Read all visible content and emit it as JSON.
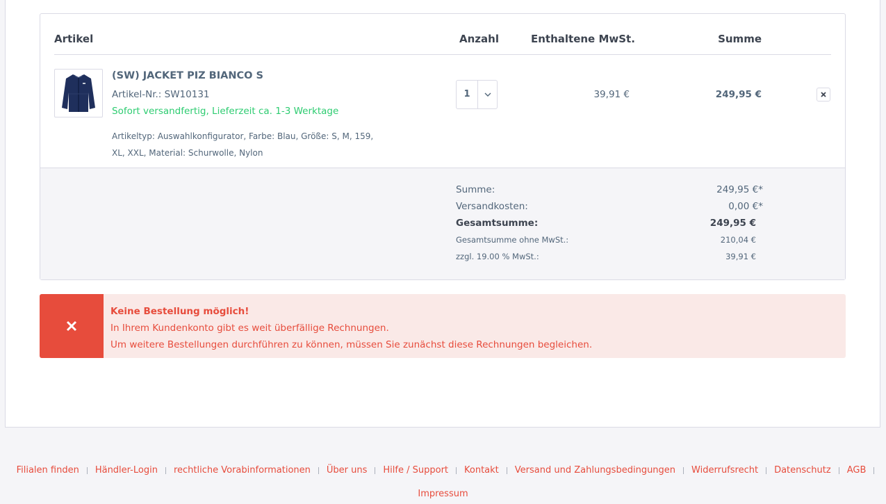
{
  "cart": {
    "headers": {
      "artikel": "Artikel",
      "anzahl": "Anzahl",
      "mwst": "Enthaltene MwSt.",
      "summe": "Summe"
    },
    "item": {
      "name": "(SW) JACKET PIZ BIANCO S",
      "article_number": "Artikel-Nr.: SW10131",
      "delivery": "Sofort versandfertig, Lieferzeit ca. 1-3 Werktage",
      "attributes": "Artikeltyp: Auswahlkonfigurator, Farbe: Blau, Größe: S, M, 159, XL, XXL, Material: Schurwolle, Nylon",
      "quantity": "1",
      "tax": "39,91 €",
      "total": "249,95 €",
      "image": "jacket-image",
      "delivery_color": "#2ecc71"
    },
    "summary": {
      "subtotal_label": "Summe:",
      "subtotal_value": "249,95 €*",
      "shipping_label": "Versandkosten:",
      "shipping_value": "0,00 €*",
      "grand_total_label": "Gesamtsumme:",
      "grand_total_value": "249,95 €",
      "net_label": "Gesamtsumme ohne MwSt.:",
      "net_value": "210,04 €",
      "vat_label": "zzgl. 19.00 % MwSt.:",
      "vat_value": "39,91 €"
    }
  },
  "alert": {
    "icon": "close-icon",
    "color": "#e74c3c",
    "title": "Keine Bestellung möglich!",
    "line1": "In Ihrem Kundenkonto gibt es weit überfällige Rechnungen.",
    "line2": "Um weitere Bestellungen durchführen zu können, müssen Sie zunächst diese Rechnungen begleichen."
  },
  "footer": {
    "links": [
      "Filialen finden",
      "Händler-Login",
      "rechtliche Vorabinformationen",
      "Über uns",
      "Hilfe / Support",
      "Kontakt",
      "Versand und Zahlungsbedingungen",
      "Widerrufsrecht",
      "Datenschutz",
      "AGB"
    ],
    "last_link": "Impressum"
  }
}
